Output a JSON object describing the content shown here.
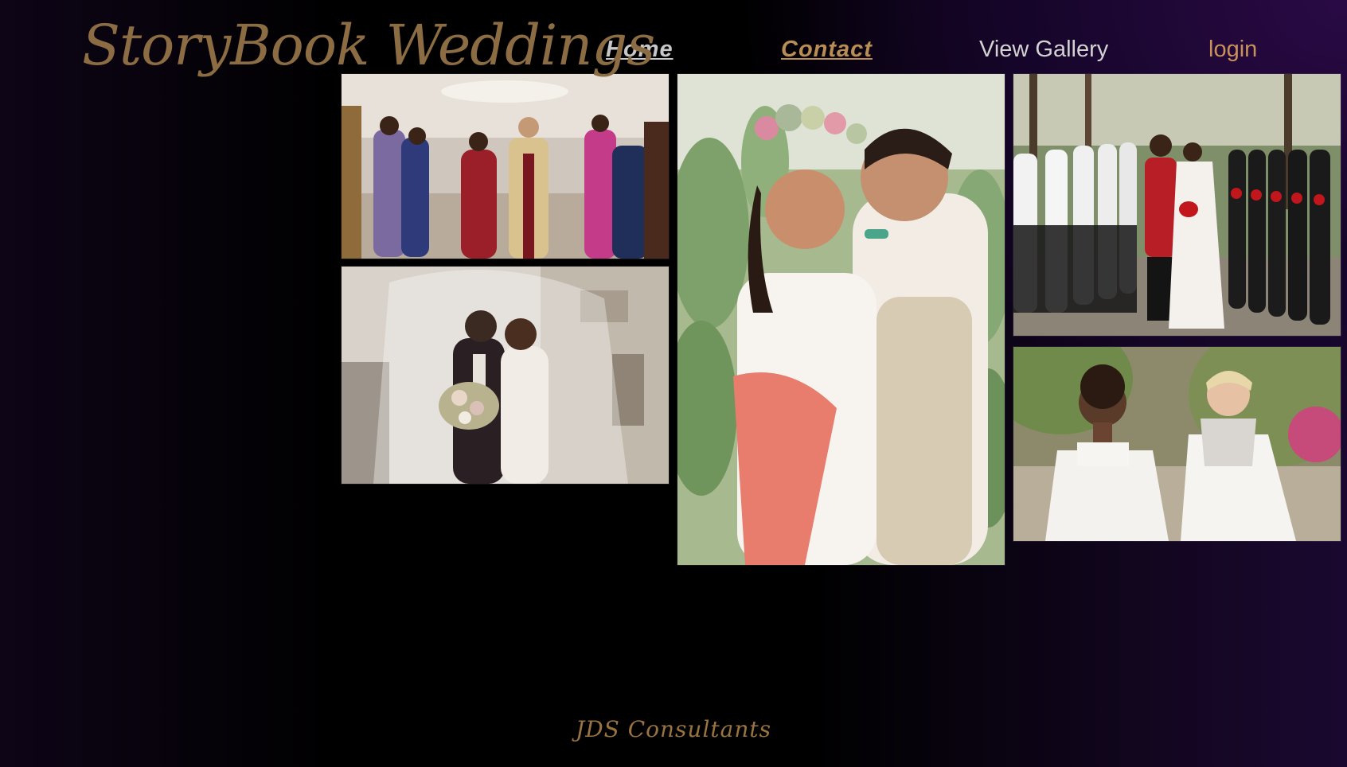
{
  "brand": {
    "title": "StoryBook Weddings"
  },
  "nav": {
    "home": "Home",
    "contact": "Contact",
    "gallery": "View Gallery",
    "login": "login"
  },
  "gallery": {
    "photos": [
      {
        "name": "indian-wedding-celebration-photo"
      },
      {
        "name": "veil-kiss-photo"
      },
      {
        "name": "floral-crown-couple-photo"
      },
      {
        "name": "wedding-party-photo"
      },
      {
        "name": "two-brides-photo"
      }
    ]
  },
  "footer": {
    "text": "JDS Consultants"
  },
  "colors": {
    "brand": "#8c6c42",
    "contact_link": "#b88e54",
    "login_link": "#c8915a",
    "home_link": "#c7c7c7",
    "gallery_link": "#d2d2d2",
    "background_accent": "#2a0a45"
  }
}
